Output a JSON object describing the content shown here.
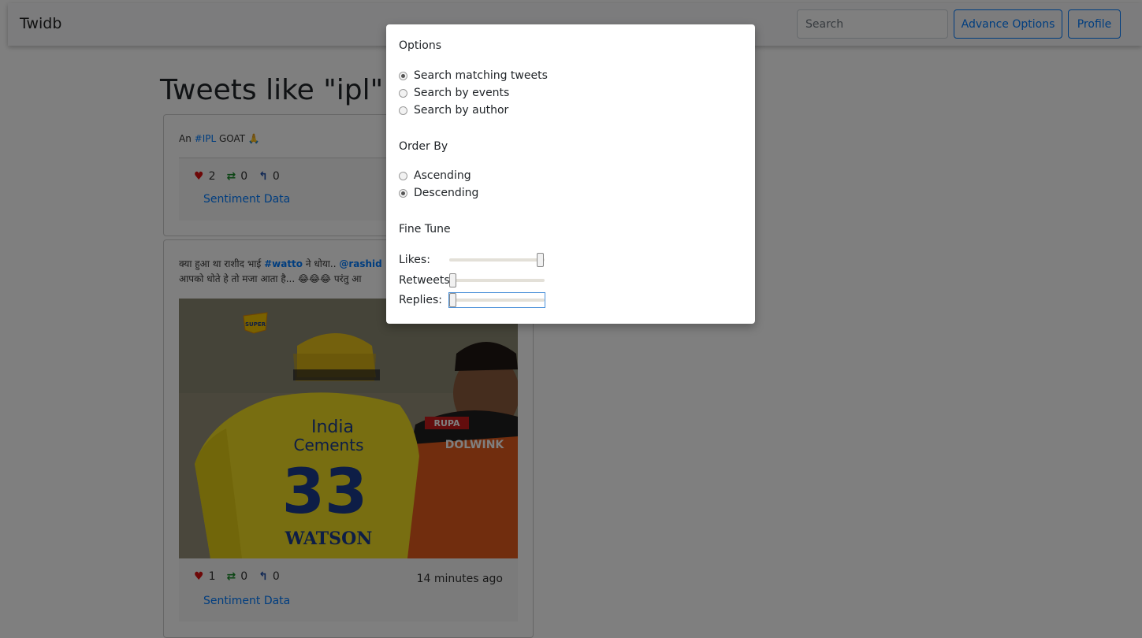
{
  "navbar": {
    "brand": "Twidb",
    "search_placeholder": "Search",
    "advance_label": "Advance Options",
    "profile_label": "Profile"
  },
  "heading": "Tweets like \"ipl\"",
  "tweets": [
    {
      "text_prefix": "An ",
      "hashtag": "#IPL",
      "text_suffix": " GOAT 🙏",
      "likes": "2",
      "retweets": "0",
      "replies": "0",
      "sentiment_label": "Sentiment Data",
      "timestamp": ""
    },
    {
      "text_line1_a": "क्या हुआ था राशीद भाई ",
      "hashtag": "#watto",
      "text_line1_b": " ने धोया.. ",
      "mention": "@rashid",
      "text_line2": "आपको धोते हे तो मजा आता है... 😂😂😂 परंतु आ",
      "likes": "1",
      "retweets": "0",
      "replies": "0",
      "sentiment_label": "Sentiment Data",
      "timestamp": "14 minutes ago",
      "image_text": {
        "jersey_line1": "India",
        "jersey_line2": "Cements",
        "number": "33",
        "name": "WATSON",
        "sponsor1": "RUPA",
        "sponsor2": "DOLWINK"
      }
    }
  ],
  "modal": {
    "options_title": "Options",
    "options": [
      {
        "label": "Search matching tweets",
        "checked": true
      },
      {
        "label": "Search by events",
        "checked": false
      },
      {
        "label": "Search by author",
        "checked": false
      }
    ],
    "order_title": "Order By",
    "order": [
      {
        "label": "Ascending",
        "checked": false
      },
      {
        "label": "Descending",
        "checked": true
      }
    ],
    "fine_tune_title": "Fine Tune",
    "sliders": [
      {
        "label": "Likes:",
        "value": 1.0
      },
      {
        "label": "Retweets:",
        "value": 0.0
      },
      {
        "label": "Replies:",
        "value": 0.0
      }
    ]
  },
  "colors": {
    "primary": "#007bff",
    "heart": "#dd1111",
    "retweet": "#1a8a2b",
    "reply": "#1f4fa8"
  }
}
